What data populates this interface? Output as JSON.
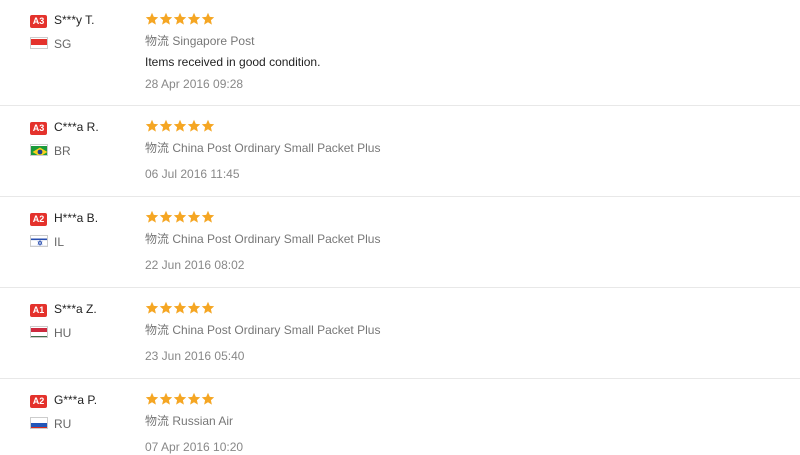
{
  "reviews": [
    {
      "level": "A3",
      "level_color": "#e4322c",
      "name": "S***y T.",
      "country": "SG",
      "flag": "sg-flag-icon",
      "stars": 5,
      "logistics_prefix": "物流",
      "logistics": "Singapore Post",
      "comment": "Items received in good condition.",
      "date": "28 Apr 2016 09:28"
    },
    {
      "level": "A3",
      "level_color": "#e4322c",
      "name": "C***a R.",
      "country": "BR",
      "flag": "br-flag-icon",
      "stars": 5,
      "logistics_prefix": "物流",
      "logistics": "China Post Ordinary Small Packet Plus",
      "comment": "",
      "date": "06 Jul 2016 11:45"
    },
    {
      "level": "A2",
      "level_color": "#e4322c",
      "name": "H***a B.",
      "country": "IL",
      "flag": "il-flag-icon",
      "stars": 5,
      "logistics_prefix": "物流",
      "logistics": "China Post Ordinary Small Packet Plus",
      "comment": "",
      "date": "22 Jun 2016 08:02"
    },
    {
      "level": "A1",
      "level_color": "#e4322c",
      "name": "S***a Z.",
      "country": "HU",
      "flag": "hu-flag-icon",
      "stars": 5,
      "logistics_prefix": "物流",
      "logistics": "China Post Ordinary Small Packet Plus",
      "comment": "",
      "date": "23 Jun 2016 05:40"
    },
    {
      "level": "A2",
      "level_color": "#e4322c",
      "name": "G***a P.",
      "country": "RU",
      "flag": "ru-flag-icon",
      "stars": 5,
      "logistics_prefix": "物流",
      "logistics": "Russian Air",
      "comment": "",
      "date": "07 Apr 2016 10:20"
    }
  ],
  "star_color": "#f5a623"
}
